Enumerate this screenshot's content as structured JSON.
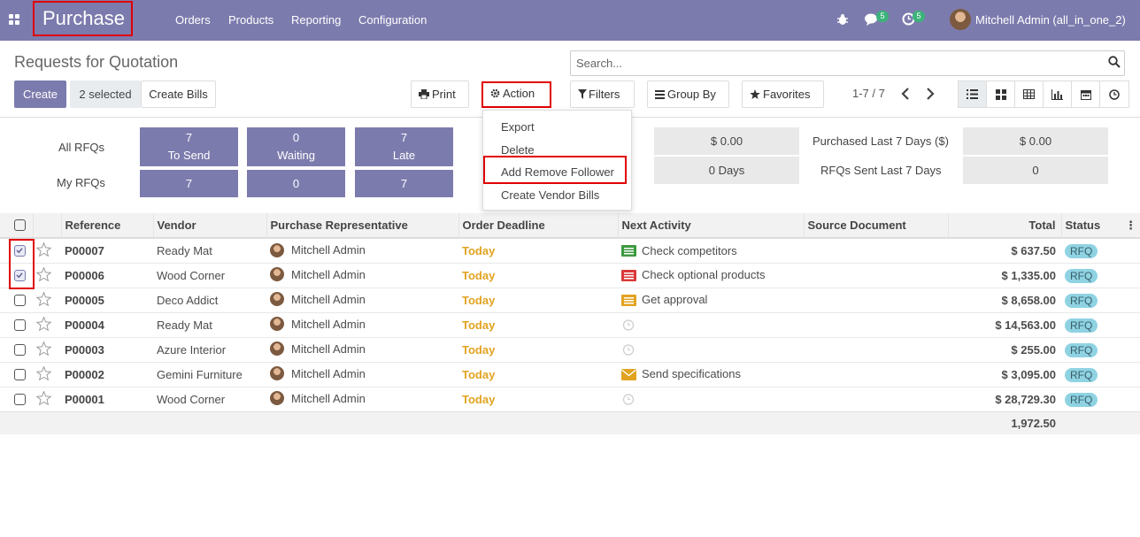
{
  "app": {
    "brand": "Purchase",
    "menu": [
      "Orders",
      "Products",
      "Reporting",
      "Configuration"
    ],
    "chat_badge": "5",
    "activity_badge": "5",
    "user": "Mitchell Admin (all_in_one_2)"
  },
  "page": {
    "title": "Requests for Quotation"
  },
  "toolbar": {
    "create": "Create",
    "selected": "2 selected",
    "create_bills": "Create Bills",
    "print": "Print",
    "action": "Action",
    "filters": "Filters",
    "group_by": "Group By",
    "favorites": "Favorites",
    "pager": "1-7 / 7"
  },
  "search": {
    "placeholder": "Search..."
  },
  "dashboard": {
    "all_rfqs_label": "All RFQs",
    "my_rfqs_label": "My RFQs",
    "tiles": [
      {
        "count": "7",
        "label": "To Send",
        "mine": "7"
      },
      {
        "count": "0",
        "label": "Waiting",
        "mine": "0"
      },
      {
        "count": "7",
        "label": "Late",
        "mine": "7"
      }
    ],
    "amount_1": "$ 0.00",
    "days_1": "0  Days",
    "purchased_label": "Purchased Last 7 Days ($)",
    "purchased_value": "$ 0.00",
    "rfqs_sent_label": "RFQs Sent Last 7 Days",
    "rfqs_sent_value": "0"
  },
  "action_menu": [
    "Export",
    "Delete",
    "Add Remove Follower",
    "Create Vendor Bills"
  ],
  "table": {
    "headers": [
      "Reference",
      "Vendor",
      "Purchase Representative",
      "Order Deadline",
      "Next Activity",
      "Source Document",
      "Total",
      "Status"
    ],
    "rows": [
      {
        "checked": true,
        "ref": "P00007",
        "vendor": "Ready Mat",
        "rep": "Mitchell Admin",
        "deadline": "Today",
        "activity": "Check competitors",
        "activity_color": "#3d9a3f",
        "activity_icon": "list-icon",
        "source": "",
        "total": "$ 637.50",
        "status": "RFQ"
      },
      {
        "checked": true,
        "ref": "P00006",
        "vendor": "Wood Corner",
        "rep": "Mitchell Admin",
        "deadline": "Today",
        "activity": "Check optional products",
        "activity_color": "#d93a3a",
        "activity_icon": "list-icon",
        "source": "",
        "total": "$ 1,335.00",
        "status": "RFQ"
      },
      {
        "checked": false,
        "ref": "P00005",
        "vendor": "Deco Addict",
        "rep": "Mitchell Admin",
        "deadline": "Today",
        "activity": "Get approval",
        "activity_color": "#e1a320",
        "activity_icon": "list-icon",
        "source": "",
        "total": "$ 8,658.00",
        "status": "RFQ"
      },
      {
        "checked": false,
        "ref": "P00004",
        "vendor": "Ready Mat",
        "rep": "Mitchell Admin",
        "deadline": "Today",
        "activity": "",
        "activity_color": "#cccccc",
        "activity_icon": "clock-icon",
        "source": "",
        "total": "$ 14,563.00",
        "status": "RFQ"
      },
      {
        "checked": false,
        "ref": "P00003",
        "vendor": "Azure Interior",
        "rep": "Mitchell Admin",
        "deadline": "Today",
        "activity": "",
        "activity_color": "#cccccc",
        "activity_icon": "clock-icon",
        "source": "",
        "total": "$ 255.00",
        "status": "RFQ"
      },
      {
        "checked": false,
        "ref": "P00002",
        "vendor": "Gemini Furniture",
        "rep": "Mitchell Admin",
        "deadline": "Today",
        "activity": "Send specifications",
        "activity_color": "#e1a320",
        "activity_icon": "envelope-icon",
        "source": "",
        "total": "$ 3,095.00",
        "status": "RFQ"
      },
      {
        "checked": false,
        "ref": "P00001",
        "vendor": "Wood Corner",
        "rep": "Mitchell Admin",
        "deadline": "Today",
        "activity": "",
        "activity_color": "#cccccc",
        "activity_icon": "clock-icon",
        "source": "",
        "total": "$ 28,729.30",
        "status": "RFQ"
      }
    ],
    "footer_total": "1,972.50"
  }
}
